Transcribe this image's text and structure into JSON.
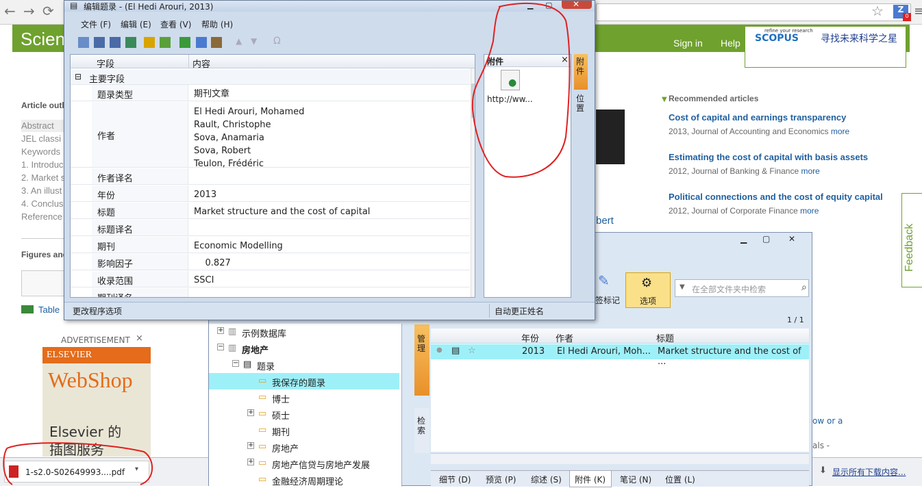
{
  "browser": {
    "download_file": "1-s2.0-S02649993....pdf",
    "show_all_downloads": "显示所有下载内容...",
    "ext_badge": "0"
  },
  "page": {
    "logo": "Scien",
    "signin": "Sign in",
    "help": "Help",
    "scopus_tag": "refine your research",
    "scopus_logo": "SCOPUS",
    "scopus_cn": "寻找未来科学之星",
    "outline_title": "Article outl",
    "outline": [
      "Abstract",
      "JEL classi",
      "Keywords",
      "1. Introduc",
      "2. Market s",
      "3. An illust",
      "4. Conclus",
      "Reference"
    ],
    "figures_title": "Figures and",
    "table_link": "Table",
    "advertisement": "ADVERTISEMENT",
    "ad_brand": "ELSEVIER",
    "ad_webshop": "WebShop",
    "ad_line1": "Elsevier 的",
    "ad_line2": "插图服务",
    "author_fragment": "bert",
    "recommended_title": "Recommended articles",
    "recommended": [
      {
        "title": "Cost of capital and earnings transparency",
        "meta": "2013, Journal of Accounting and Economics ",
        "more": "more"
      },
      {
        "title": "Estimating the cost of capital with basis assets",
        "meta": "2012, Journal of Banking & Finance ",
        "more": "more"
      },
      {
        "title": "Political connections and the cost of equity capital",
        "meta": "2012, Journal of Corporate Finance ",
        "more": "more"
      }
    ],
    "feedback": "Feedback",
    "frag_a": "ow or a",
    "frag_b": "als -"
  },
  "dialog": {
    "title": "编辑题录 - (El Hedi Arouri, 2013)",
    "menu": [
      "文件 (F)",
      "编辑 (E)",
      "查看 (V)",
      "帮助 (H)"
    ],
    "col_field": "字段",
    "col_content": "内容",
    "group": "主要字段",
    "rows": [
      {
        "f": "题录类型",
        "v": "期刊文章"
      },
      {
        "f": "作者",
        "v": "El Hedi Arouri, Mohamed\nRault, Christophe\nSova, Anamaria\nSova, Robert\nTeulon, Frédéric"
      },
      {
        "f": "作者译名",
        "v": ""
      },
      {
        "f": "年份",
        "v": "2013"
      },
      {
        "f": "标题",
        "v": "Market structure and the cost of capital"
      },
      {
        "f": "标题译名",
        "v": ""
      },
      {
        "f": "期刊",
        "v": "Economic Modelling"
      },
      {
        "f": "影响因子",
        "v": "    0.827"
      },
      {
        "f": "收录范围",
        "v": "SSCI"
      },
      {
        "f": "期刊译名",
        "v": ""
      }
    ],
    "attach_title": "附件",
    "attach_close": "×",
    "attach_item": "http://ww...",
    "side_tab1": "附件",
    "side_tab2": "位置",
    "status_left": "更改程序选项",
    "status_right": "自动更正姓名"
  },
  "main": {
    "search_placeholder": "在全部文件夹中检索",
    "options": "选项",
    "label_btn": "签标记",
    "page_count": "1 / 1",
    "tree": [
      {
        "label": "示例数据库",
        "indent": 0,
        "expander": "+"
      },
      {
        "label": "房地产",
        "indent": 0,
        "expander": "−",
        "bold": true
      },
      {
        "label": "题录",
        "indent": 1,
        "expander": "−"
      },
      {
        "label": "我保存的题录",
        "indent": 2,
        "expander": "",
        "selected": true
      },
      {
        "label": "博士",
        "indent": 2,
        "expander": ""
      },
      {
        "label": "硕士",
        "indent": 2,
        "expander": "+"
      },
      {
        "label": "期刊",
        "indent": 2,
        "expander": ""
      },
      {
        "label": "房地产",
        "indent": 2,
        "expander": "+"
      },
      {
        "label": "房地产信贷与房地产发展",
        "indent": 2,
        "expander": "+"
      },
      {
        "label": "金融经济周期理论",
        "indent": 2,
        "expander": ""
      }
    ],
    "vtab_manage": "管理",
    "vtab_search": "检索",
    "columns": [
      "年份",
      "作者",
      "标题"
    ],
    "row": {
      "year": "2013",
      "author": "El Hedi Arouri, Moh...",
      "title": "Market structure and the cost of ..."
    },
    "tabs": [
      "细节 (D)",
      "预览 (P)",
      "综述 (S)",
      "附件 (K)",
      "笔记 (N)",
      "位置 (L)"
    ]
  }
}
